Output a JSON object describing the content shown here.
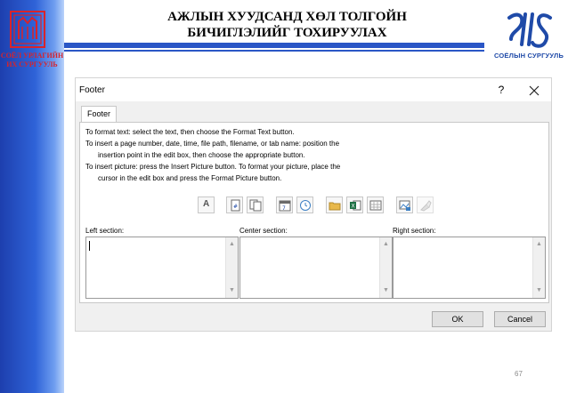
{
  "slide": {
    "title_line1": "АЖЛЫН ХУУДСАНД ХӨЛ ТОЛГОЙН",
    "title_line2": "БИЧИГЛЭЛИЙГ ТОХИРУУЛАХ",
    "left_logo_caption_line1": "СОЁЛ УРЛАГИЙН",
    "left_logo_caption_line2": "ИХ СУРГУУЛЬ",
    "right_logo_caption": "СОЁЛЫН СУРГУУЛЬ",
    "page_number": "67",
    "colors": {
      "band_blue": "#2f63d8",
      "rule_blue": "#2a56c6",
      "logo_red": "#d9232a",
      "logo_blue": "#1f4aa8"
    }
  },
  "dialog": {
    "title": "Footer",
    "help_label": "?",
    "close_icon": "close-icon",
    "tab_label": "Footer",
    "instructions": [
      "To format text:  select the text, then choose the Format Text button.",
      "To insert a page number, date, time, file path, filename, or tab name:  position the",
      "insertion point in the edit box, then choose the appropriate button.",
      "To insert picture: press the Insert Picture button.  To format your picture, place the",
      "cursor in the edit box and press the Format Picture button."
    ],
    "toolbar": {
      "format_text_label": "A",
      "icons": [
        "format-text-icon",
        "page-number-icon",
        "number-of-pages-icon",
        "date-icon",
        "time-icon",
        "file-path-icon",
        "file-name-icon",
        "sheet-name-icon",
        "insert-picture-icon",
        "format-picture-icon"
      ]
    },
    "sections": {
      "left_label": "Left section:",
      "center_label": "Center section:",
      "right_label": "Right section:",
      "left_value": "",
      "center_value": "",
      "right_value": ""
    },
    "ok_label": "OK",
    "cancel_label": "Cancel"
  }
}
